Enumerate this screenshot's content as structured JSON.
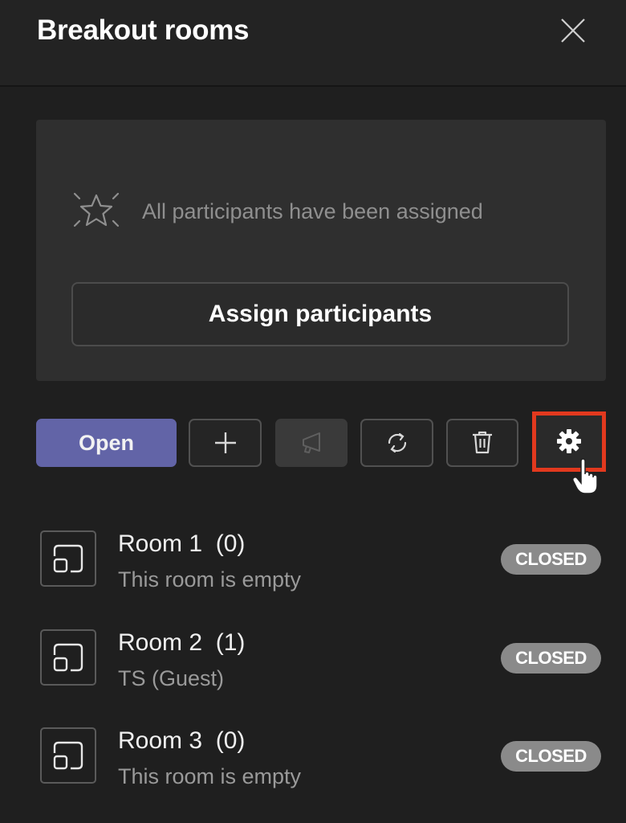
{
  "header": {
    "title": "Breakout rooms",
    "close_icon": "close-icon"
  },
  "assignment_card": {
    "status_icon": "sparkle-star-icon",
    "status_text": "All participants have been assigned",
    "assign_button_label": "Assign participants"
  },
  "toolbar": {
    "open_label": "Open",
    "buttons": [
      {
        "name": "add-room",
        "icon": "plus-icon",
        "enabled": true
      },
      {
        "name": "announcement",
        "icon": "megaphone-icon",
        "enabled": false
      },
      {
        "name": "recreate-rooms",
        "icon": "refresh-icon",
        "enabled": true
      },
      {
        "name": "delete-rooms",
        "icon": "trash-icon",
        "enabled": true
      },
      {
        "name": "room-settings",
        "icon": "gear-icon",
        "enabled": true,
        "highlighted": true
      }
    ],
    "highlight_color": "#e2391e",
    "accent_color": "#6264a7"
  },
  "rooms": [
    {
      "name": "Room 1",
      "count": "(0)",
      "subtitle": "This room is empty",
      "status": "CLOSED"
    },
    {
      "name": "Room 2",
      "count": "(1)",
      "subtitle": "TS (Guest)",
      "status": "CLOSED"
    },
    {
      "name": "Room 3",
      "count": "(0)",
      "subtitle": "This room is empty",
      "status": "CLOSED"
    }
  ]
}
